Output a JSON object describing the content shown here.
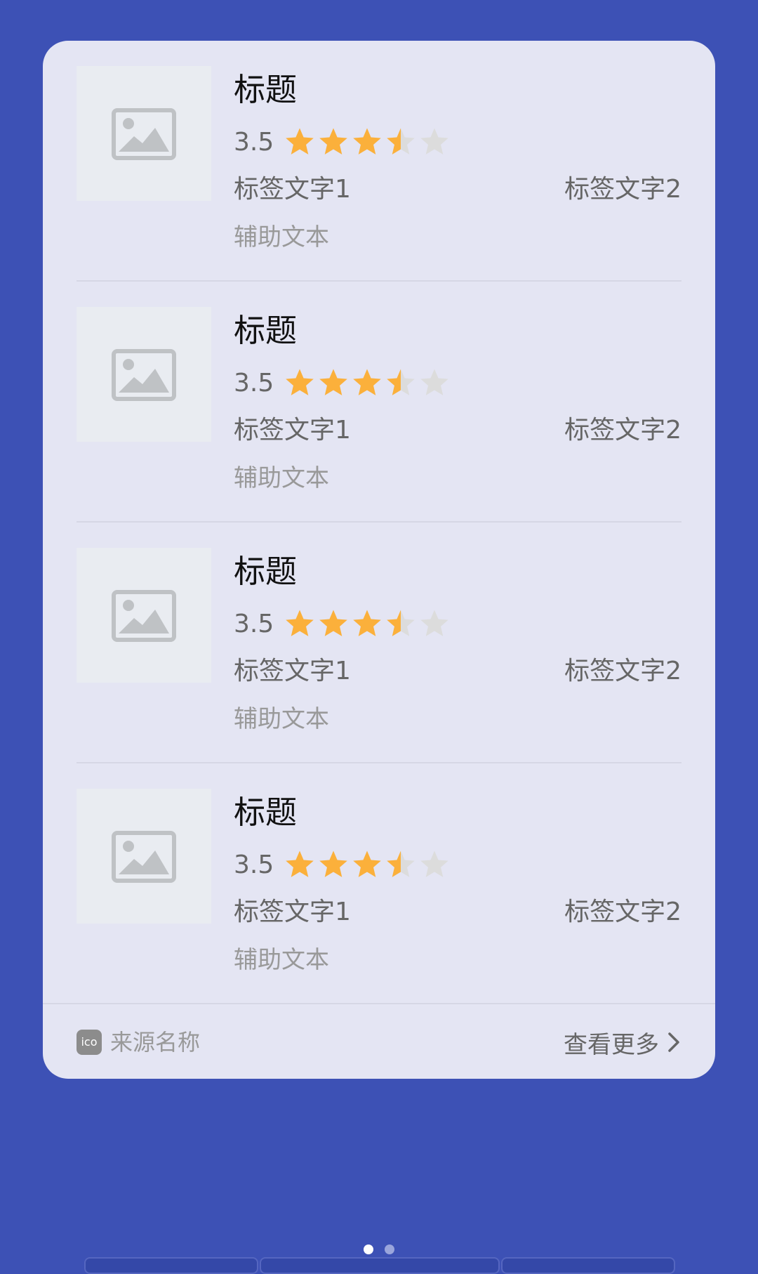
{
  "colors": {
    "background": "#3d51b5",
    "card": "#e4e5f3",
    "star_filled": "#fbb03b",
    "star_empty": "#dcdcdc"
  },
  "items": [
    {
      "title": "标题",
      "rating": "3.5",
      "rating_value": 3.5,
      "rating_max": 5,
      "tag_left": "标签文字1",
      "tag_right": "标签文字2",
      "aux_text": "辅助文本",
      "image_icon": "image-placeholder-icon"
    },
    {
      "title": "标题",
      "rating": "3.5",
      "rating_value": 3.5,
      "rating_max": 5,
      "tag_left": "标签文字1",
      "tag_right": "标签文字2",
      "aux_text": "辅助文本",
      "image_icon": "image-placeholder-icon"
    },
    {
      "title": "标题",
      "rating": "3.5",
      "rating_value": 3.5,
      "rating_max": 5,
      "tag_left": "标签文字1",
      "tag_right": "标签文字2",
      "aux_text": "辅助文本",
      "image_icon": "image-placeholder-icon"
    },
    {
      "title": "标题",
      "rating": "3.5",
      "rating_value": 3.5,
      "rating_max": 5,
      "tag_left": "标签文字1",
      "tag_right": "标签文字2",
      "aux_text": "辅助文本",
      "image_icon": "image-placeholder-icon"
    }
  ],
  "footer": {
    "source_icon_text": "ico",
    "source_name": "来源名称",
    "more_label": "查看更多",
    "more_icon": "chevron-right-icon"
  },
  "pager": {
    "count": 2,
    "active_index": 0
  }
}
